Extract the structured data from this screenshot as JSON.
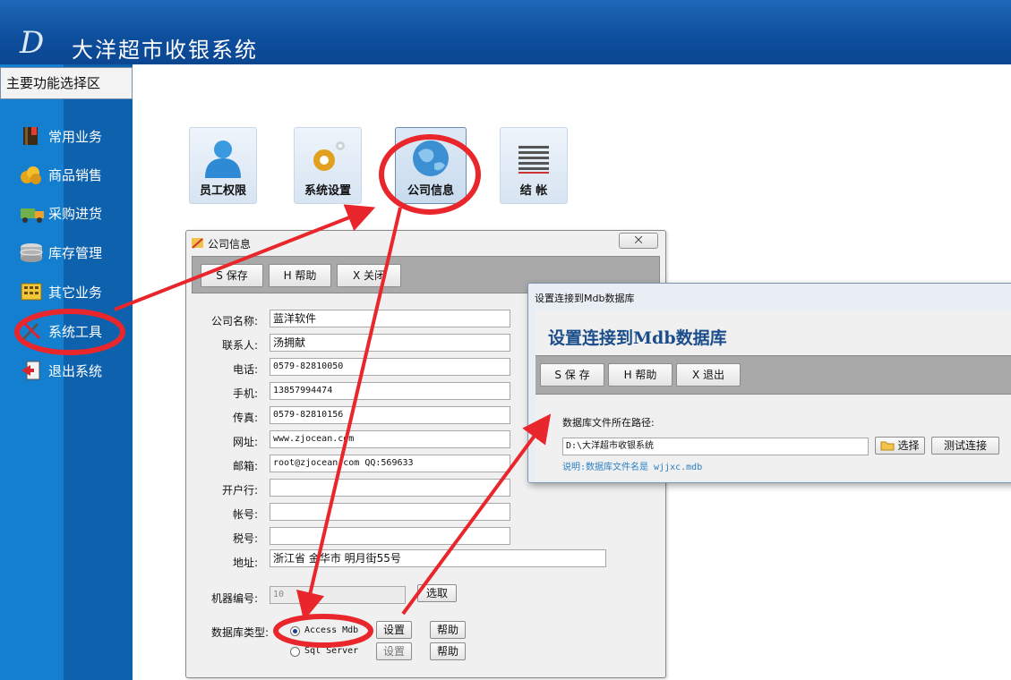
{
  "app": {
    "title": "大洋超市收银系统",
    "logo": "D"
  },
  "sidebar": {
    "title": "主要功能选择区",
    "items": [
      {
        "label": "常用业务",
        "icon": "book-icon"
      },
      {
        "label": "商品销售",
        "icon": "coins-icon"
      },
      {
        "label": "采购进货",
        "icon": "truck-icon"
      },
      {
        "label": "库存管理",
        "icon": "database-icon"
      },
      {
        "label": "其它业务",
        "icon": "calculator-icon"
      },
      {
        "label": "系统工具",
        "icon": "tools-icon"
      },
      {
        "label": "退出系统",
        "icon": "exit-icon"
      }
    ]
  },
  "toolbar": [
    {
      "label": "员工权限",
      "icon": "user-icon"
    },
    {
      "label": "系统设置",
      "icon": "gear-icon"
    },
    {
      "label": "公司信息",
      "icon": "globe-icon"
    },
    {
      "label": "结 帐",
      "icon": "ledger-icon"
    }
  ],
  "company_dialog": {
    "title": "公司信息",
    "close": "⨉",
    "buttons": {
      "save": "S 保存",
      "help": "H 帮助",
      "close": "X 关闭"
    },
    "fields": {
      "name": {
        "label": "公司名称:",
        "value": "蓝洋软件"
      },
      "contact": {
        "label": "联系人:",
        "value": "汤拥献"
      },
      "phone": {
        "label": "电话:",
        "value": "0579-82810050"
      },
      "mobile": {
        "label": "手机:",
        "value": "13857994474"
      },
      "fax": {
        "label": "传真:",
        "value": "0579-82810156"
      },
      "website": {
        "label": "网址:",
        "value": "www.zjocean.com"
      },
      "email": {
        "label": "邮箱:",
        "value": "root@zjocean.com  QQ:569633"
      },
      "bank": {
        "label": "开户行:",
        "value": ""
      },
      "account": {
        "label": "帐号:",
        "value": ""
      },
      "tax": {
        "label": "税号:",
        "value": ""
      },
      "address": {
        "label": "地址:",
        "value": "浙江省 金华市 明月街55号"
      }
    },
    "machine": {
      "label": "机器编号:",
      "value": "10",
      "button": "选取"
    },
    "db": {
      "label": "数据库类型:",
      "options": [
        {
          "label": "Access Mdb",
          "selected": true,
          "set": "设置",
          "help": "帮助"
        },
        {
          "label": "Sql Server",
          "selected": false,
          "set": "设置",
          "help": "帮助"
        }
      ]
    }
  },
  "mdb_dialog": {
    "title": "设置连接到Mdb数据库",
    "heading": "设置连接到Mdb数据库",
    "buttons": {
      "save": "S 保 存",
      "help": "H 帮助",
      "exit": "X 退出"
    },
    "path_label": "数据库文件所在路径:",
    "path_value": "D:\\大洋超市收银系统",
    "browse": "选择",
    "test": "测试连接",
    "note": "说明:数据库文件名是 wjjxc.mdb"
  },
  "colors": {
    "header": "#0d4e9c",
    "sidebar": "#147fcf",
    "highlight": "#e8262b",
    "heading": "#1b4d8a"
  }
}
